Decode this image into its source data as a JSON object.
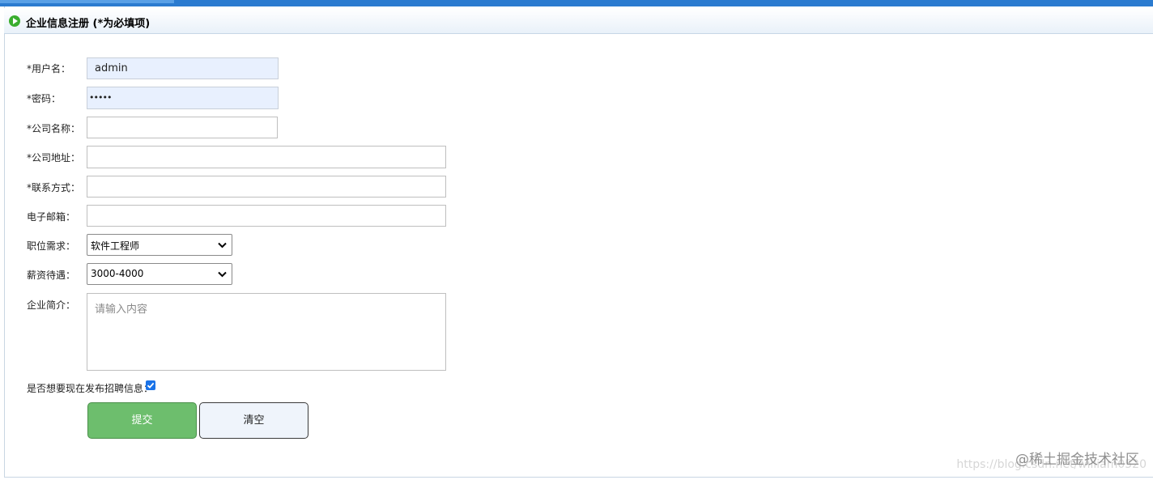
{
  "header": {
    "title": "企业信息注册 (*为必填项)"
  },
  "form": {
    "username": {
      "label": "*用户名：",
      "value": "admin"
    },
    "password": {
      "label": "*密码：",
      "value": "•••••"
    },
    "company_name": {
      "label": "*公司名称：",
      "value": ""
    },
    "company_address": {
      "label": "*公司地址：",
      "value": ""
    },
    "contact": {
      "label": "*联系方式：",
      "value": ""
    },
    "email": {
      "label": "电子邮箱：",
      "value": ""
    },
    "position": {
      "label": "职位需求：",
      "selected": "软件工程师"
    },
    "salary": {
      "label": "薪资待遇：",
      "selected": "3000-4000"
    },
    "intro": {
      "label": "企业简介：",
      "placeholder": "请输入内容"
    },
    "publish_now": {
      "label": "是否想要现在发布招聘信息：",
      "checked": true
    }
  },
  "buttons": {
    "submit": "提交",
    "clear": "清空"
  },
  "watermark": {
    "logo": "@稀土掘金技术社区",
    "url": "https://blog.csdn.net/william0520"
  },
  "colors": {
    "topbar": "#2b7bd0",
    "submit": "#6dbe6d",
    "autofill": "#e8f0fe",
    "checkbox": "#1a73e8"
  }
}
